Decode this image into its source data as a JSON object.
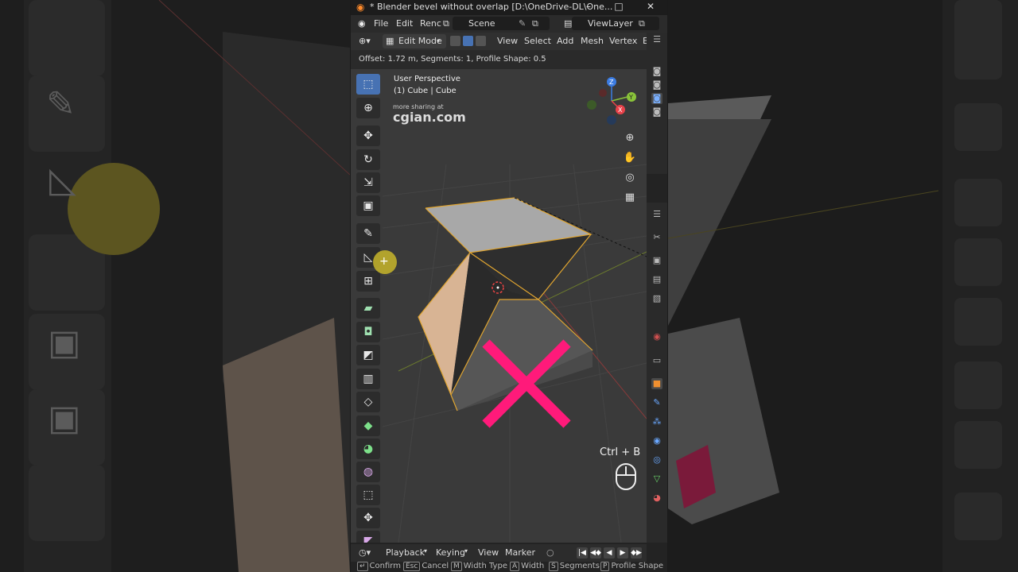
{
  "window": {
    "title": "* Blender bevel without overlap [D:\\OneDrive-DL\\One...",
    "minimize": "–",
    "maximize": "□",
    "close": "✕"
  },
  "menubar": {
    "file": "File",
    "edit": "Edit",
    "render": "Renc",
    "scene": "Scene",
    "view_layer": "ViewLayer"
  },
  "header": {
    "mode": "Edit Mode",
    "view": "View",
    "select": "Select",
    "add": "Add",
    "mesh": "Mesh",
    "vertex": "Vertex",
    "overflow": "E"
  },
  "operator_status": "Offset: 1.72 m, Segments: 1, Profile Shape: 0.5",
  "viewport": {
    "perspective": "User Perspective",
    "object": "(1) Cube | Cube",
    "watermark_small": "more sharing at",
    "watermark_big": "cgian.com",
    "shortcut": "Ctrl + B",
    "gizmo": {
      "z": "Z",
      "y": "Y",
      "x": "X"
    },
    "colors": {
      "x": "#e8424a",
      "y": "#8ac33a",
      "z": "#3b7ce2",
      "cross": "#ff1a7a",
      "selection": "#e0a530"
    }
  },
  "timeline": {
    "playback": "Playback",
    "keying": "Keying",
    "view": "View",
    "marker": "Marker"
  },
  "statusbar": {
    "hints": [
      {
        "key": "↵",
        "label": "Confirm"
      },
      {
        "key": "Esc",
        "label": "Cancel"
      },
      {
        "key": "M",
        "label": "Width Type"
      },
      {
        "key": "A",
        "label": "Width"
      },
      {
        "key": "S",
        "label": "Segments"
      },
      {
        "key": "P",
        "label": "Profile Shape"
      }
    ]
  },
  "toolbar_icons": [
    "select-box-icon",
    "cursor-icon",
    "move-icon",
    "rotate-icon",
    "scale-icon",
    "transform-icon",
    "annotate-icon",
    "measure-icon",
    "add-cube-icon",
    "extrude-icon",
    "inset-icon",
    "bevel-icon",
    "loop-cut-icon",
    "knife-icon",
    "poly-build-icon",
    "spin-icon",
    "smooth-icon",
    "shrink-fatten-icon",
    "shear-icon",
    "rip-icon"
  ]
}
